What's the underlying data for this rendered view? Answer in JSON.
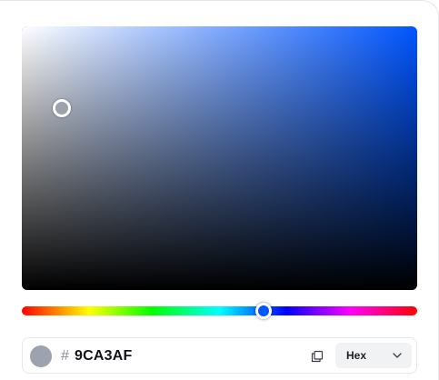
{
  "picker": {
    "base_hue_color": "#0055ff",
    "selected_color": "#9CA3AF",
    "saturation": 0.1,
    "brightness": 0.69,
    "hue_degrees": 220
  },
  "value_row": {
    "hash_symbol": "#",
    "hex_value": "9CA3AF",
    "copy_icon": "copy-icon",
    "format_label": "Hex",
    "format_icon": "chevron-down-icon"
  }
}
